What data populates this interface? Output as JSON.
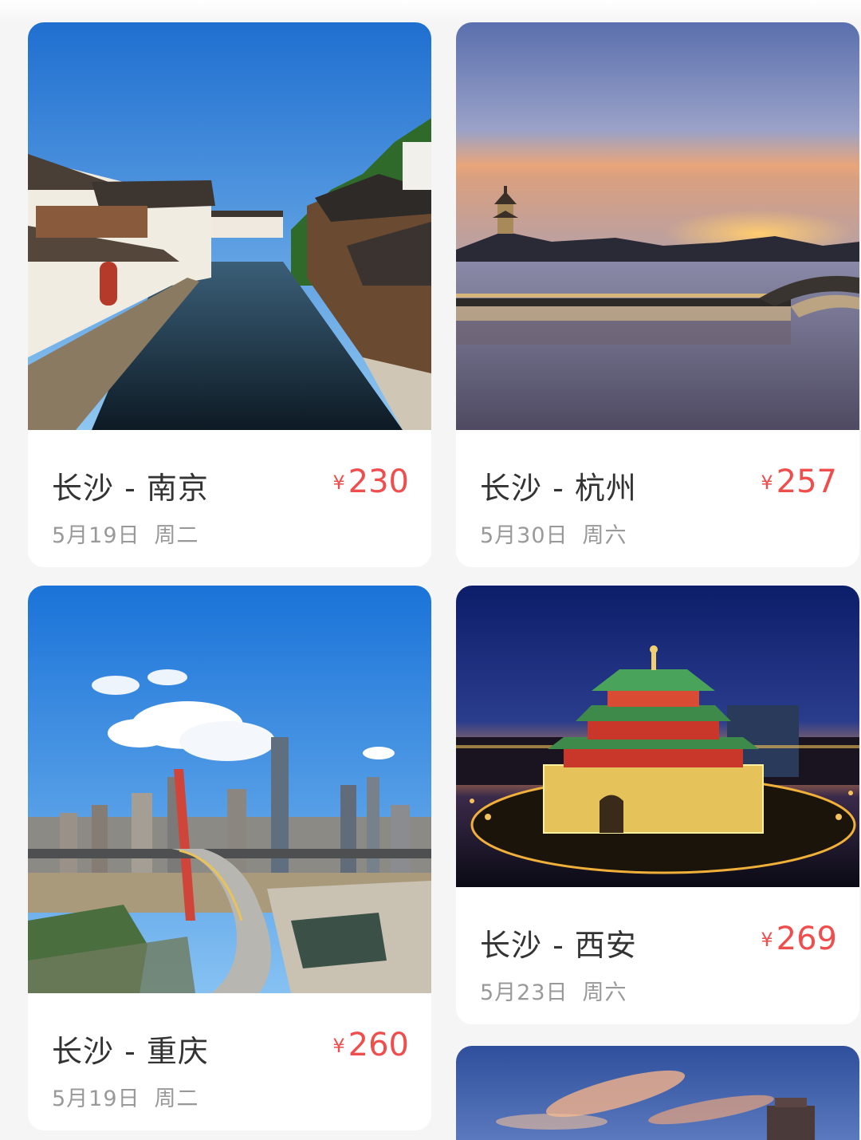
{
  "currency_symbol": "¥",
  "colors": {
    "price": "#f04d4d",
    "route_text": "#333333",
    "date_text": "#999999",
    "card_bg": "#ffffff",
    "page_bg": "#f5f5f5"
  },
  "cards": [
    {
      "route": "长沙 - 南京",
      "price": "230",
      "date": "5月19日",
      "weekday": "周二",
      "photo": "water-town-canal"
    },
    {
      "route": "长沙 - 杭州",
      "price": "257",
      "date": "5月30日",
      "weekday": "周六",
      "photo": "west-lake-sunset-pagoda"
    },
    {
      "route": "长沙 - 重庆",
      "price": "260",
      "date": "5月19日",
      "weekday": "周二",
      "photo": "city-skyline-bridge"
    },
    {
      "route": "长沙 - 西安",
      "price": "269",
      "date": "5月23日",
      "weekday": "周六",
      "photo": "bell-tower-night"
    },
    {
      "photo": "sunset-sky-tower"
    }
  ]
}
